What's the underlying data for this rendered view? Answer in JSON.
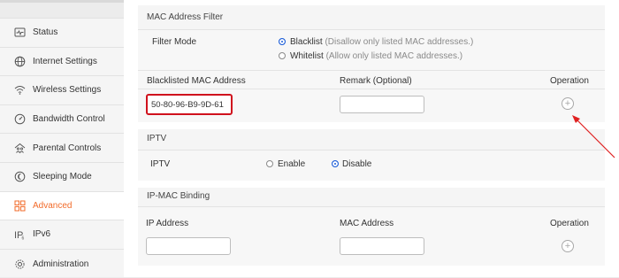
{
  "sidebar": {
    "items": [
      {
        "label": "Status",
        "icon": "status-icon",
        "active": false
      },
      {
        "label": "Internet Settings",
        "icon": "globe-icon",
        "active": false
      },
      {
        "label": "Wireless Settings",
        "icon": "wifi-icon",
        "active": false
      },
      {
        "label": "Bandwidth Control",
        "icon": "gauge-icon",
        "active": false
      },
      {
        "label": "Parental Controls",
        "icon": "family-icon",
        "active": false
      },
      {
        "label": "Sleeping Mode",
        "icon": "moon-icon",
        "active": false
      },
      {
        "label": "Advanced",
        "icon": "grid-icon",
        "active": true
      },
      {
        "label": "IPv6",
        "icon": "ipv6-icon",
        "active": false
      },
      {
        "label": "Administration",
        "icon": "gear-icon",
        "active": false
      }
    ],
    "accent_color": "#f26b2a"
  },
  "mac_filter": {
    "title": "MAC Address Filter",
    "filter_mode_label": "Filter Mode",
    "blacklist_label": "Blacklist",
    "blacklist_desc": "(Disallow only listed MAC addresses.)",
    "whitelist_label": "Whitelist",
    "whitelist_desc": "(Allow only listed MAC addresses.)",
    "selected_mode": "Blacklist",
    "col_mac": "Blacklisted MAC Address",
    "col_remark": "Remark (Optional)",
    "col_operation": "Operation",
    "mac_value": "50-80-96-B9-9D-61",
    "remark_value": ""
  },
  "iptv": {
    "title": "IPTV",
    "label": "IPTV",
    "enable_label": "Enable",
    "disable_label": "Disable",
    "selected": "Disable"
  },
  "ip_mac_binding": {
    "title": "IP-MAC Binding",
    "col_ip": "IP Address",
    "col_mac": "MAC Address",
    "col_operation": "Operation",
    "ip_value": "",
    "mac_value": ""
  },
  "annotation": {
    "highlight_color": "#d0111d",
    "arrow_target": "add-mac-filter-button"
  }
}
